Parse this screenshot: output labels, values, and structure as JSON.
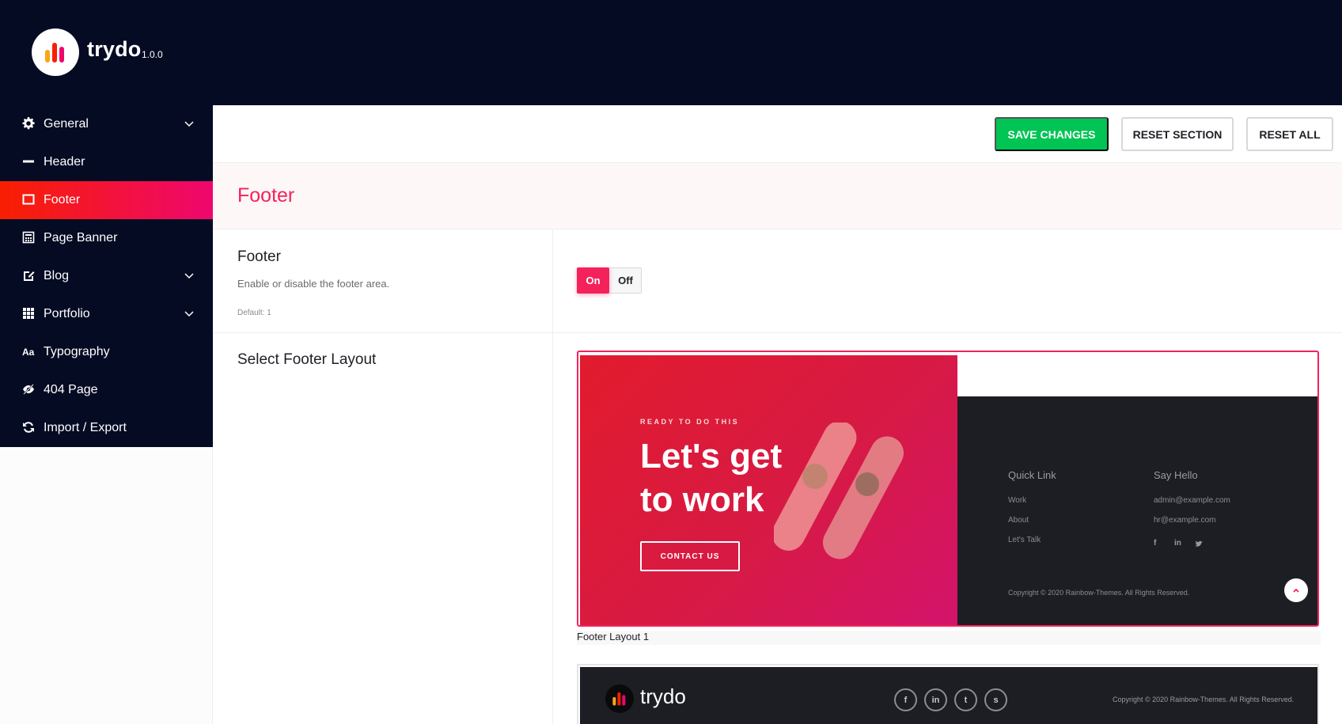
{
  "app": {
    "brand": "trydo",
    "version": "1.0.0"
  },
  "sidebar": {
    "items": [
      {
        "label": "General",
        "icon": "gear-icon",
        "has_chevron": true,
        "active": false
      },
      {
        "label": "Header",
        "icon": "minus-icon",
        "has_chevron": false,
        "active": false
      },
      {
        "label": "Footer",
        "icon": "window-icon",
        "has_chevron": false,
        "active": true
      },
      {
        "label": "Page Banner",
        "icon": "calculator-icon",
        "has_chevron": false,
        "active": false
      },
      {
        "label": "Blog",
        "icon": "edit-icon",
        "has_chevron": true,
        "active": false
      },
      {
        "label": "Portfolio",
        "icon": "grid-icon",
        "has_chevron": true,
        "active": false
      },
      {
        "label": "Typography",
        "icon": "font-icon",
        "has_chevron": false,
        "active": false
      },
      {
        "label": "404 Page",
        "icon": "eye-slash-icon",
        "has_chevron": false,
        "active": false
      },
      {
        "label": "Import / Export",
        "icon": "refresh-icon",
        "has_chevron": false,
        "active": false
      }
    ]
  },
  "toolbar": {
    "save_label": "SAVE CHANGES",
    "reset_section_label": "RESET SECTION",
    "reset_all_label": "RESET ALL"
  },
  "section": {
    "title": "Footer",
    "fields": {
      "footer": {
        "title": "Footer",
        "description": "Enable or disable the footer area.",
        "default": "Default: 1",
        "on_label": "On",
        "off_label": "Off",
        "value": "On"
      },
      "layout": {
        "title": "Select Footer Layout"
      }
    }
  },
  "layouts": {
    "layout1": {
      "caption": "Footer Layout 1",
      "selected": true,
      "ready": "READY TO DO THIS",
      "headline_line1": "Let's get",
      "headline_line2": "to work",
      "contact": "CONTACT US",
      "quick_link_title": "Quick Link",
      "quick_links": [
        "Work",
        "About",
        "Let's Talk"
      ],
      "say_hello_title": "Say Hello",
      "emails": [
        "admin@example.com",
        "hr@example.com"
      ],
      "socials": [
        "f",
        "in",
        "t"
      ],
      "copyright": "Copyright © 2020 Rainbow-Themes. All Rights Reserved."
    },
    "layout2": {
      "brand": "trydo",
      "socials": [
        "f",
        "in",
        "t",
        "s"
      ],
      "copyright": "Copyright © 2020 Rainbow-Themes. All Rights Reserved."
    }
  },
  "colors": {
    "sidebar_bg": "#050b23",
    "accent": "#f4225b",
    "save_green": "#00c454",
    "active_gradient_start": "#f81f01",
    "active_gradient_end": "#ee076e"
  }
}
